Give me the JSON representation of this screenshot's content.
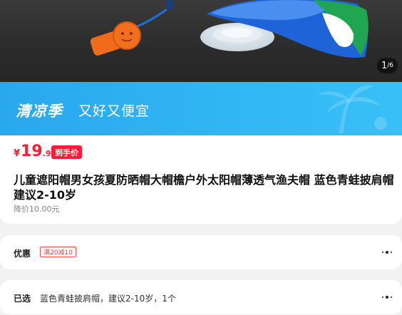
{
  "gallery": {
    "current_page": "1",
    "separator": "/",
    "total_pages": "6"
  },
  "promo": {
    "title": "清凉季",
    "subtitle": "又好又便宜",
    "background_color": "#31b5f3"
  },
  "price": {
    "currency": "¥",
    "integer": "19",
    "decimal": ".90",
    "badge": "到手价",
    "accent_color": "#ff1b3a"
  },
  "product": {
    "title": "儿童遮阳帽男女孩夏防晒帽大帽檐户外太阳帽薄透气渔夫帽 蓝色青蛙披肩帽 建议2-10岁",
    "original_price": "降价10.00元"
  },
  "offers": {
    "label": "优惠",
    "coupon": "满20减10"
  },
  "selection": {
    "label": "已选",
    "value": "蓝色青蛙披肩帽，建议2-10岁，1个"
  }
}
